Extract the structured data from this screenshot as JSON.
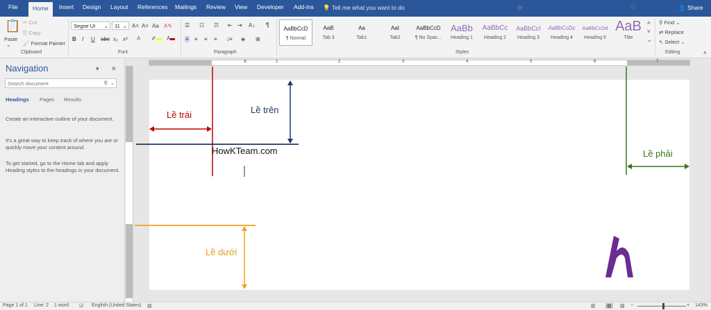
{
  "tabs": [
    "File",
    "Home",
    "Insert",
    "Design",
    "Layout",
    "References",
    "Mailings",
    "Review",
    "View",
    "Developer",
    "Add-ins"
  ],
  "tell_me": "Tell me what you want to do",
  "share": "Share",
  "clipboard": {
    "paste": "Paste",
    "cut": "Cut",
    "copy": "Copy",
    "format_painter": "Format Painter",
    "group": "Clipboard"
  },
  "font": {
    "name": "Segoe UI",
    "size": "11",
    "group": "Font"
  },
  "paragraph": {
    "group": "Paragraph"
  },
  "styles": {
    "group": "Styles",
    "items": [
      {
        "preview": "AaBbCcD",
        "label": "¶ Normal"
      },
      {
        "preview": "AaB",
        "label": "Tab 3"
      },
      {
        "preview": "Aa",
        "label": "Tab1"
      },
      {
        "preview": "AaI",
        "label": "Tab2"
      },
      {
        "preview": "AaBbCcD",
        "label": "¶ No Spac..."
      },
      {
        "preview": "AaBb",
        "label": "Heading 1"
      },
      {
        "preview": "AaBbCc",
        "label": "Heading 2"
      },
      {
        "preview": "AaBbCcI",
        "label": "Heading 3"
      },
      {
        "preview": "AaBbCcDc",
        "label": "Heading 4"
      },
      {
        "preview": "AaBbCcDd",
        "label": "Heading 5"
      },
      {
        "preview": "AaB",
        "label": "Title"
      }
    ]
  },
  "editing": {
    "find": "Find",
    "replace": "Replace",
    "select": "Select",
    "group": "Editing"
  },
  "nav": {
    "title": "Navigation",
    "search_placeholder": "Search document",
    "tabs": [
      "Headings",
      "Pages",
      "Results"
    ],
    "p1": "Create an interactive outline of your document.",
    "p2": "It's a great way to keep track of where you are or quickly move your content around.",
    "p3": "To get started, go to the Home tab and apply Heading styles to the headings in your document."
  },
  "ruler_numbers": [
    "1",
    "1",
    "2",
    "3",
    "4",
    "5",
    "6",
    "7"
  ],
  "doc": {
    "watermark_text": "HowKTeam.com",
    "labels": {
      "left": "Lề trái",
      "top": "Lề trên",
      "right": "Lề phải",
      "bottom": "Lề dưới"
    },
    "colors": {
      "left": "#c00000",
      "top": "#1f3864",
      "right": "#38761d",
      "bottom": "#f1a31b",
      "logo": "#6a2c91"
    }
  },
  "status": {
    "page": "Page 1 of 1",
    "line": "Line: 2",
    "words": "1 word",
    "language": "English (United States)",
    "zoom": "143%"
  }
}
